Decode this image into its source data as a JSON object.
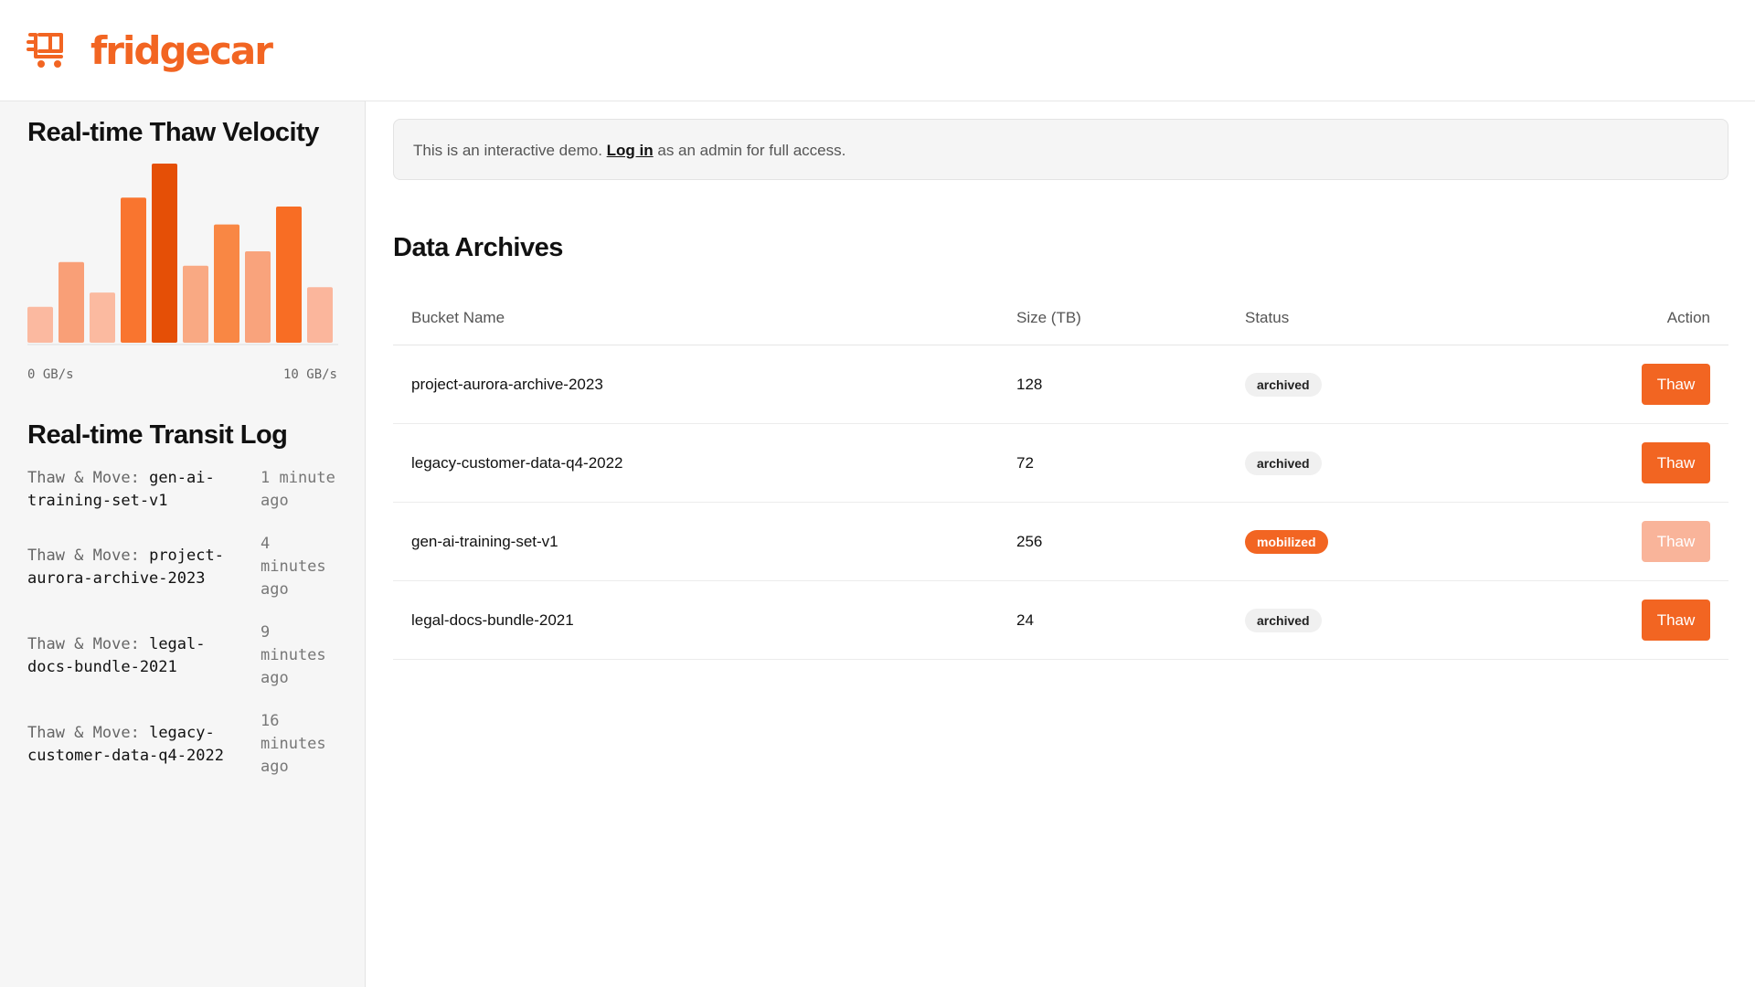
{
  "brand": {
    "name": "fridgecar",
    "color": "#f26522",
    "icon": "cart-icon"
  },
  "sidebar": {
    "velocity_title": "Real-time Thaw Velocity",
    "axis_min": "0 GB/s",
    "axis_max": "10 GB/s",
    "log_title": "Real-time Transit Log",
    "log": [
      {
        "label": "Thaw & Move:",
        "name": "gen-ai-training-set-v1",
        "time": "1 minute ago"
      },
      {
        "label": "Thaw & Move:",
        "name": "project-aurora-archive-2023",
        "time": "4 minutes ago"
      },
      {
        "label": "Thaw & Move:",
        "name": "legal-docs-bundle-2021",
        "time": "9 minutes ago"
      },
      {
        "label": "Thaw & Move:",
        "name": "legacy-customer-data-q4-2022",
        "time": "16 minutes ago"
      }
    ]
  },
  "chart_data": {
    "type": "bar",
    "values": [
      2,
      4.5,
      2.8,
      8.1,
      10,
      4.3,
      6.6,
      5.1,
      7.6,
      3.1
    ],
    "highlight_index": 4,
    "ylim": [
      0,
      10
    ],
    "xlabel": "",
    "ylabel": "",
    "colors": [
      "#fbb9a0",
      "#f99f77",
      "#fbbaa0",
      "#f9752f",
      "#e54f06",
      "#f9a983",
      "#f98744",
      "#f9a37c",
      "#f86d24",
      "#fbb69c"
    ]
  },
  "banner": {
    "prefix": "This is an interactive demo. ",
    "link": "Log in",
    "suffix": " as an admin for full access."
  },
  "main": {
    "title": "Data Archives",
    "columns": [
      "Bucket Name",
      "Size (TB)",
      "Status",
      "Action"
    ],
    "rows": [
      {
        "name": "project-aurora-archive-2023",
        "size": "128",
        "status": "archived",
        "action": "Thaw",
        "disabled": false
      },
      {
        "name": "legacy-customer-data-q4-2022",
        "size": "72",
        "status": "archived",
        "action": "Thaw",
        "disabled": false
      },
      {
        "name": "gen-ai-training-set-v1",
        "size": "256",
        "status": "mobilized",
        "action": "Thaw",
        "disabled": true
      },
      {
        "name": "legal-docs-bundle-2021",
        "size": "24",
        "status": "archived",
        "action": "Thaw",
        "disabled": false
      }
    ]
  }
}
